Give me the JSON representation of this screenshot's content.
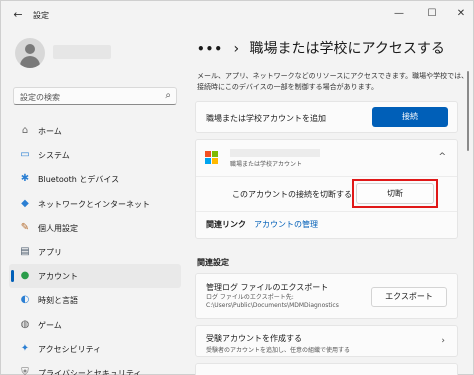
{
  "window": {
    "title": "設定",
    "back_glyph": "←",
    "minimize_glyph": "—",
    "maximize_glyph": "☐",
    "close_glyph": "✕"
  },
  "search": {
    "placeholder": "設定の検索",
    "icon": "search-icon"
  },
  "sidebar": {
    "items": [
      {
        "label": "ホーム",
        "icon": "home-icon",
        "glyph": "⌂",
        "color": "#6b6b6b"
      },
      {
        "label": "システム",
        "icon": "system-icon",
        "glyph": "▭",
        "color": "#2b7fd3"
      },
      {
        "label": "Bluetooth とデバイス",
        "icon": "bluetooth-icon",
        "glyph": "✱",
        "color": "#2b7fd3"
      },
      {
        "label": "ネットワークとインターネット",
        "icon": "network-icon",
        "glyph": "◆",
        "color": "#2b7fd3"
      },
      {
        "label": "個人用設定",
        "icon": "personalization-icon",
        "glyph": "✎",
        "color": "#b46a2b"
      },
      {
        "label": "アプリ",
        "icon": "apps-icon",
        "glyph": "▤",
        "color": "#4a5a6b"
      },
      {
        "label": "アカウント",
        "icon": "account-icon",
        "glyph": "●",
        "color": "#2a9d4a",
        "active": true
      },
      {
        "label": "時刻と言語",
        "icon": "time-language-icon",
        "glyph": "◐",
        "color": "#2b7fd3"
      },
      {
        "label": "ゲーム",
        "icon": "gaming-icon",
        "glyph": "◍",
        "color": "#5a5a5a"
      },
      {
        "label": "アクセシビリティ",
        "icon": "accessibility-icon",
        "glyph": "✦",
        "color": "#2b7fd3"
      },
      {
        "label": "プライバシーとセキュリティ",
        "icon": "shield-icon",
        "glyph": "⛨",
        "color": "#6b6b6b"
      }
    ]
  },
  "breadcrumb": {
    "dots": "•••",
    "separator": "›",
    "title": "職場または学校にアクセスする"
  },
  "description": "メール、アプリ、ネットワークなどのリソースにアクセスできます。職場や学校では、接続時にこのデバイスの一部を制御する場合があります。",
  "add_account": {
    "label": "職場または学校アカウントを追加",
    "button": "接続"
  },
  "account_card": {
    "subtitle": "職場または学校アカウント",
    "collapse_glyph": "^",
    "disconnect_label": "このアカウントの接続を切断する",
    "disconnect_button": "切断",
    "related_links_label": "関連リンク",
    "manage_account_link": "アカウントの管理"
  },
  "related_settings": {
    "heading": "関連設定",
    "export": {
      "title": "管理ログ ファイルのエクスポート",
      "subtitle": "ログ ファイルのエクスポート先: C:\\Users\\Public\\Documents\\MDMDiagnostics",
      "button": "エクスポート"
    },
    "exam": {
      "title": "受験アカウントを作成する",
      "subtitle": "受験者のアカウントを追加し、任意の組織で使用する",
      "chevron": "›"
    }
  },
  "colors": {
    "accent": "#005fb8",
    "highlight": "#e01818",
    "ms_red": "#f25022",
    "ms_green": "#7fba00",
    "ms_blue": "#00a4ef",
    "ms_yellow": "#ffb900"
  }
}
